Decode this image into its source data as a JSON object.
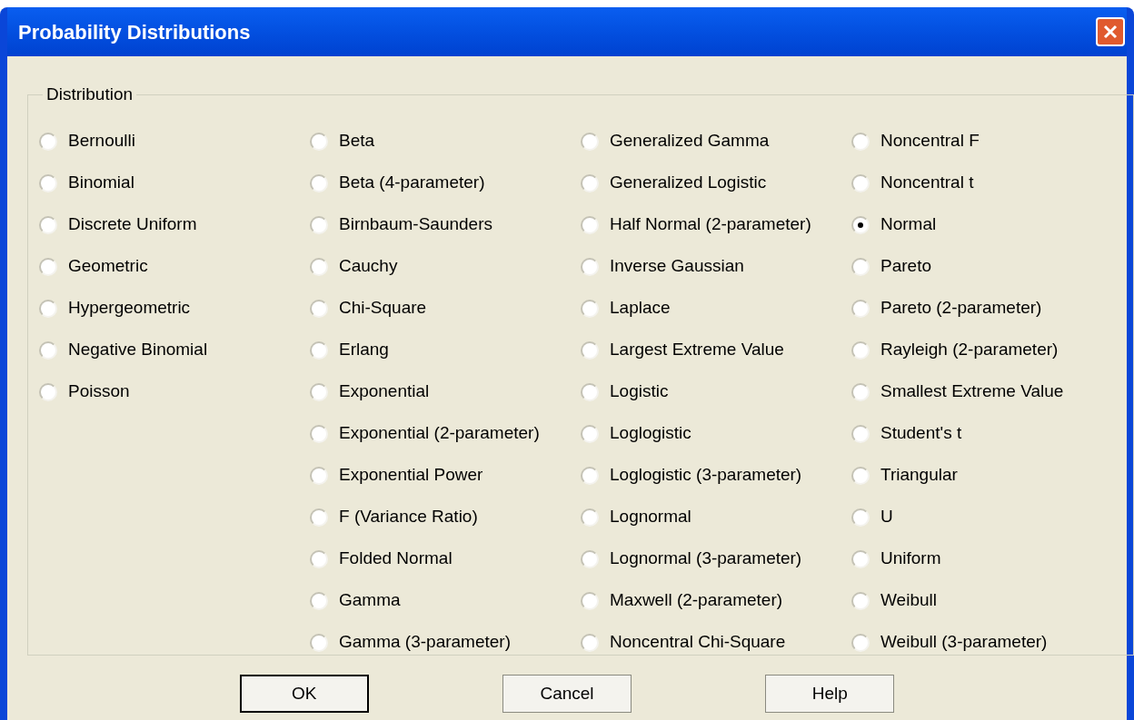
{
  "window": {
    "title": "Probability Distributions"
  },
  "group": {
    "label": "Distribution",
    "columns": [
      [
        {
          "label": "Bernoulli",
          "selected": false
        },
        {
          "label": "Binomial",
          "selected": false
        },
        {
          "label": "Discrete Uniform",
          "selected": false
        },
        {
          "label": "Geometric",
          "selected": false
        },
        {
          "label": "Hypergeometric",
          "selected": false
        },
        {
          "label": "Negative Binomial",
          "selected": false
        },
        {
          "label": "Poisson",
          "selected": false
        }
      ],
      [
        {
          "label": "Beta",
          "selected": false
        },
        {
          "label": "Beta (4-parameter)",
          "selected": false
        },
        {
          "label": "Birnbaum-Saunders",
          "selected": false
        },
        {
          "label": "Cauchy",
          "selected": false
        },
        {
          "label": "Chi-Square",
          "selected": false
        },
        {
          "label": "Erlang",
          "selected": false
        },
        {
          "label": "Exponential",
          "selected": false
        },
        {
          "label": "Exponential (2-parameter)",
          "selected": false
        },
        {
          "label": "Exponential Power",
          "selected": false
        },
        {
          "label": "F (Variance Ratio)",
          "selected": false
        },
        {
          "label": "Folded Normal",
          "selected": false
        },
        {
          "label": "Gamma",
          "selected": false
        },
        {
          "label": "Gamma (3-parameter)",
          "selected": false
        }
      ],
      [
        {
          "label": "Generalized Gamma",
          "selected": false
        },
        {
          "label": "Generalized Logistic",
          "selected": false
        },
        {
          "label": "Half Normal (2-parameter)",
          "selected": false
        },
        {
          "label": "Inverse Gaussian",
          "selected": false
        },
        {
          "label": "Laplace",
          "selected": false
        },
        {
          "label": "Largest Extreme Value",
          "selected": false
        },
        {
          "label": "Logistic",
          "selected": false
        },
        {
          "label": "Loglogistic",
          "selected": false
        },
        {
          "label": "Loglogistic (3-parameter)",
          "selected": false
        },
        {
          "label": "Lognormal",
          "selected": false
        },
        {
          "label": "Lognormal (3-parameter)",
          "selected": false
        },
        {
          "label": "Maxwell (2-parameter)",
          "selected": false
        },
        {
          "label": "Noncentral Chi-Square",
          "selected": false
        }
      ],
      [
        {
          "label": "Noncentral F",
          "selected": false
        },
        {
          "label": "Noncentral t",
          "selected": false
        },
        {
          "label": "Normal",
          "selected": true
        },
        {
          "label": "Pareto",
          "selected": false
        },
        {
          "label": "Pareto (2-parameter)",
          "selected": false
        },
        {
          "label": "Rayleigh (2-parameter)",
          "selected": false
        },
        {
          "label": "Smallest Extreme Value",
          "selected": false
        },
        {
          "label": "Student's t",
          "selected": false
        },
        {
          "label": "Triangular",
          "selected": false
        },
        {
          "label": "U",
          "selected": false
        },
        {
          "label": "Uniform",
          "selected": false
        },
        {
          "label": "Weibull",
          "selected": false
        },
        {
          "label": "Weibull (3-parameter)",
          "selected": false
        }
      ]
    ]
  },
  "buttons": [
    {
      "label": "OK",
      "default": true
    },
    {
      "label": "Cancel",
      "default": false
    },
    {
      "label": "Help",
      "default": false
    }
  ]
}
